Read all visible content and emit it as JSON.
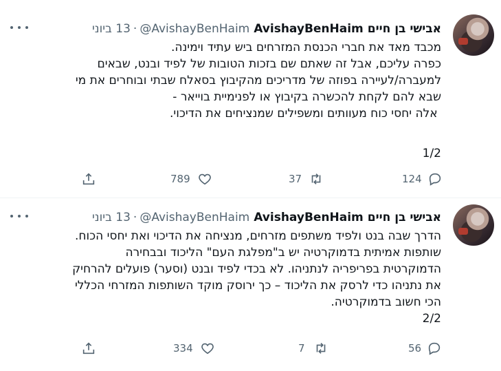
{
  "tweets": [
    {
      "author_name": "אבישי בן חיים",
      "handle_name": "AvishayBenHaim",
      "handle": "@AvishayBenHaim",
      "date": "13 ביוני",
      "lines": [
        "מכבד מאד את חברי הכנסת המזרחים ביש עתיד וימינה.",
        "כפרה עליכם, אבל זה שאתם שם בזכות הטובות של לפיד ובנט, שבאים",
        "למעברה/לעיירה בפוזה של מדריכים מהקיבוץ בסאלח שבתי ובוחרים את מי",
        "שבא להם לקחת להכשרה בקיבוץ או לפנימיית בוייאר -",
        " אלה יחסי כוח מעוותים ומשפילים שמנציחים את הדיכוי.",
        "",
        "1/2"
      ],
      "replies": "124",
      "retweets": "37",
      "likes": "789"
    },
    {
      "author_name": "אבישי בן חיים",
      "handle_name": "AvishayBenHaim",
      "handle": "@AvishayBenHaim",
      "date": "13 ביוני",
      "lines": [
        "הדרך שבה בנט ולפיד משתפים מזרחים, מנציחה את הדיכוי ואת יחסי הכוח.",
        "שותפות אמיתית בדמוקרטיה יש ב\"מפלגת העם\" הליכוד ובבחירה",
        "הדמוקרטית בפריפריה לנתניהו. לא בכדי לפיד ובנט (וסער) פועלים להרחיק",
        "את נתניהו כדי לרסק את הליכוד – כך ירוסק מוקד השותפות המזרחי הכללי",
        "הכי חשוב בדמוקרטיה.",
        "2/2"
      ],
      "replies": "56",
      "retweets": "7",
      "likes": "334"
    }
  ],
  "icons": {
    "more": "more-icon",
    "reply": "reply-icon",
    "retweet": "retweet-icon",
    "like": "like-icon",
    "share": "share-icon"
  },
  "colors": {
    "text": "#0f1419",
    "secondary": "#536471",
    "divider": "#eff3f4"
  }
}
